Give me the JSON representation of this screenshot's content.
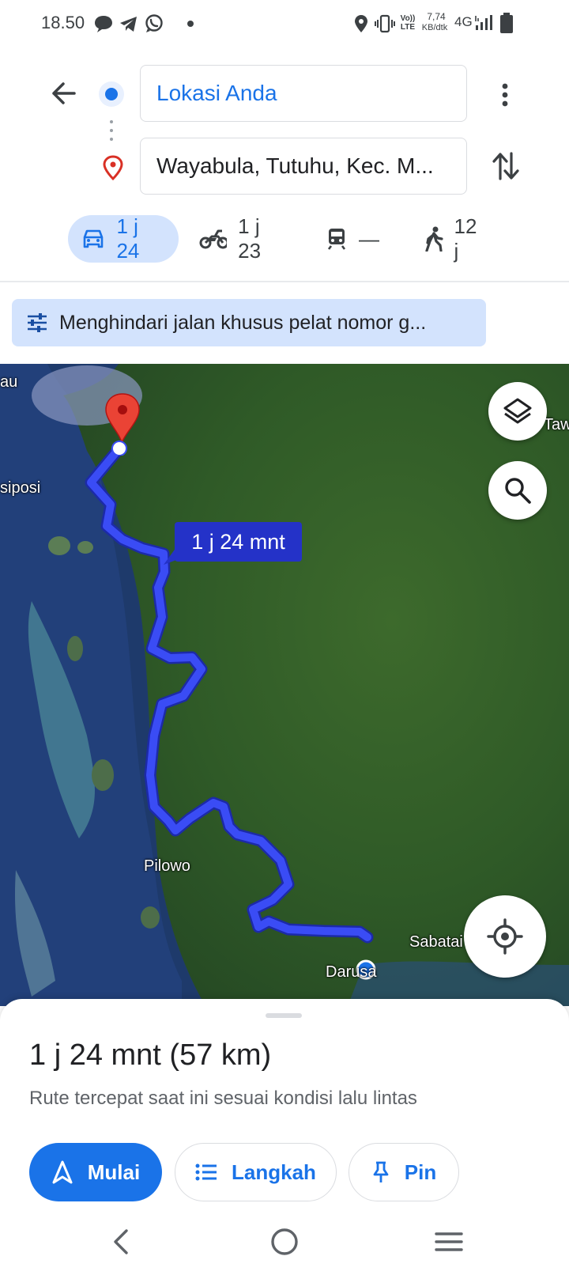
{
  "status_bar": {
    "time": "18.50",
    "volte": "Vo))\nLTE",
    "speed_value": "7,74",
    "speed_unit": "KB/dtk",
    "network": "4G",
    "icons": [
      "chat-bubble-icon",
      "telegram-icon",
      "whatsapp-icon",
      "dot-icon",
      "location-icon",
      "vibrate-icon",
      "signal-icon",
      "battery-icon"
    ]
  },
  "header": {
    "origin_value": "Lokasi Anda",
    "destination_value": "Wayabula, Tutuhu, Kec. M...",
    "icons": [
      "back-arrow-icon",
      "origin-dot-icon",
      "destination-pin-icon",
      "more-vert-icon",
      "swap-icon"
    ]
  },
  "travel_modes": [
    {
      "mode": "car",
      "label": "1 j 24",
      "selected": true,
      "icon": "car-icon"
    },
    {
      "mode": "motorcycle",
      "label": "1 j 23",
      "selected": false,
      "icon": "motorcycle-icon"
    },
    {
      "mode": "transit",
      "label": "—",
      "selected": false,
      "icon": "train-icon"
    },
    {
      "mode": "walk",
      "label": "12 j",
      "selected": false,
      "icon": "walk-icon"
    }
  ],
  "banner": {
    "label": "Menghindari jalan khusus pelat nomor g...",
    "icon": "tune-icon"
  },
  "map": {
    "route_label": "1 j 24 mnt",
    "places": {
      "au": "au",
      "siposi": "siposi",
      "tawi": "Tawi",
      "pilowo": "Pilowo",
      "sabatai": "Sabatai",
      "darusa": "Darusa"
    },
    "icons": [
      "layers-icon",
      "search-icon",
      "my-location-icon",
      "destination-marker-icon",
      "current-position-icon"
    ],
    "route_color": "#3a4cf5"
  },
  "sheet": {
    "summary": "1 j 24 mnt (57 km)",
    "subtitle": "Rute tercepat saat ini sesuai kondisi lalu lintas",
    "buttons": {
      "start": "Mulai",
      "steps": "Langkah",
      "pin": "Pin"
    }
  },
  "colors": {
    "accent": "#1a73e8",
    "chip_selected": "#d3e3fd",
    "banner_bg": "#d3e3fd"
  }
}
